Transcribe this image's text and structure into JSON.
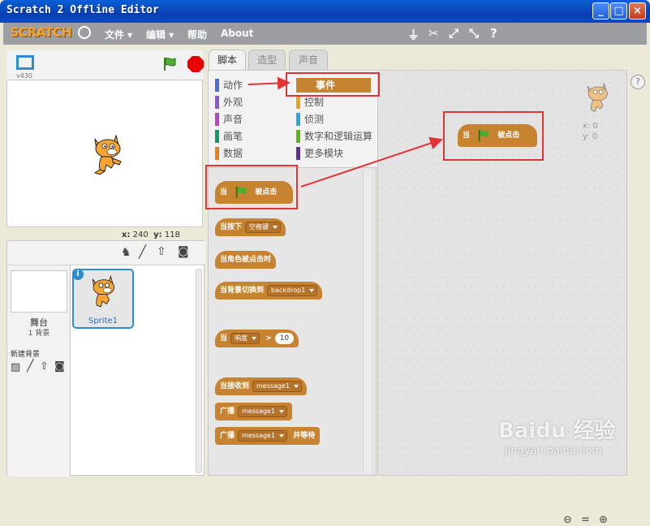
{
  "window": {
    "title": "Scratch 2 Offline Editor",
    "min": "_",
    "max": "□",
    "close": "×"
  },
  "menubar": {
    "logo": "SCRATCH",
    "items": [
      "文件 ▾",
      "编辑 ▾",
      "帮助",
      "About"
    ]
  },
  "stage": {
    "version": "v430",
    "x_label": "x:",
    "x_value": "240",
    "y_label": "y:",
    "y_value": "118"
  },
  "sprites": {
    "stage_label": "舞台",
    "backdrop_count": "1 背景",
    "new_backdrop": "新建背景",
    "sprite_name": "Sprite1"
  },
  "tabs": [
    "脚本",
    "造型",
    "声音"
  ],
  "categories_left": [
    {
      "label": "动作",
      "color": "#4a6cd4"
    },
    {
      "label": "外观",
      "color": "#8a55d7"
    },
    {
      "label": "声音",
      "color": "#bb42c3"
    },
    {
      "label": "画笔",
      "color": "#0e9a6c"
    },
    {
      "label": "数据",
      "color": "#ee7d16"
    }
  ],
  "categories_right": [
    {
      "label": "事件",
      "color": "#c88330"
    },
    {
      "label": "控制",
      "color": "#e1a91a"
    },
    {
      "label": "侦测",
      "color": "#2ca5e2"
    },
    {
      "label": "数字和逻辑运算",
      "color": "#5cb712"
    },
    {
      "label": "更多模块",
      "color": "#632d99"
    }
  ],
  "blocks": {
    "when_flag_pre": "当",
    "when_flag_post": "被点击",
    "when_key": "当按下",
    "key_option": "空格键",
    "when_sprite_clicked": "当角色被点击时",
    "when_backdrop": "当背景切换到",
    "backdrop_option": "backdrop1",
    "when_sensor": "当",
    "sensor_option": "响度",
    "sensor_op": ">",
    "sensor_value": "10",
    "when_receive": "当接收到",
    "message_option": "message1",
    "broadcast": "广播",
    "broadcast_wait": "广播",
    "and_wait": "并等待"
  },
  "script_area": {
    "x_label": "x: 0",
    "y_label": "y: 0",
    "help": "?",
    "zoom_out": "⊖",
    "zoom_reset": "=",
    "zoom_in": "⊕"
  },
  "watermark": {
    "text": "Baidu 经验",
    "url": "jingyan.baidu.com"
  }
}
